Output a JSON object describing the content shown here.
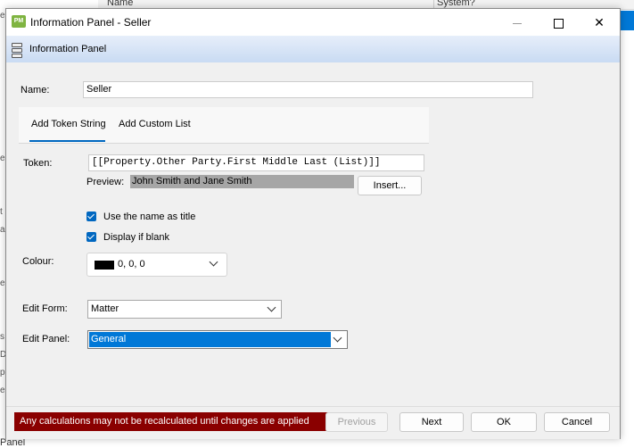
{
  "background": {
    "columns": [
      "Name",
      "System?"
    ],
    "bottom_text": "Panel",
    "left_letters": [
      "e",
      "e",
      "t",
      "a",
      "e",
      "s",
      "D",
      "p",
      "e"
    ]
  },
  "window": {
    "title": "Information Panel - Seller",
    "app_icon": "PM",
    "minimize_icon": "minimize-icon",
    "maximize_icon": "maximize-icon",
    "close_icon": "close-icon",
    "close_glyph": "✕"
  },
  "panel_header": {
    "icon": "database-icon",
    "title": "Information Panel"
  },
  "form": {
    "name_label": "Name:",
    "name_value": "Seller",
    "tabs": [
      {
        "label": "Add Token String",
        "active": true
      },
      {
        "label": "Add Custom List",
        "active": false
      }
    ],
    "token_label": "Token:",
    "token_value": "[[Property.Other Party.First Middle Last (List)]]",
    "preview_label": "Preview:",
    "preview_value": "John Smith and Jane Smith",
    "insert_button": "Insert...",
    "checkbox_title": "Use the name as title",
    "checkbox_blank": "Display if blank",
    "colour_label": "Colour:",
    "colour_value": "0, 0, 0",
    "colour_hex": "#000000",
    "edit_form_label": "Edit Form:",
    "edit_form_value": "Matter",
    "edit_panel_label": "Edit Panel:",
    "edit_panel_value": "General"
  },
  "footer": {
    "warning": "Any calculations may not be recalculated until changes are applied",
    "previous": "Previous",
    "next": "Next",
    "ok": "OK",
    "cancel": "Cancel"
  },
  "colors": {
    "accent": "#0067c0",
    "selection": "#0078d7",
    "warning_bg": "#8a0000"
  }
}
